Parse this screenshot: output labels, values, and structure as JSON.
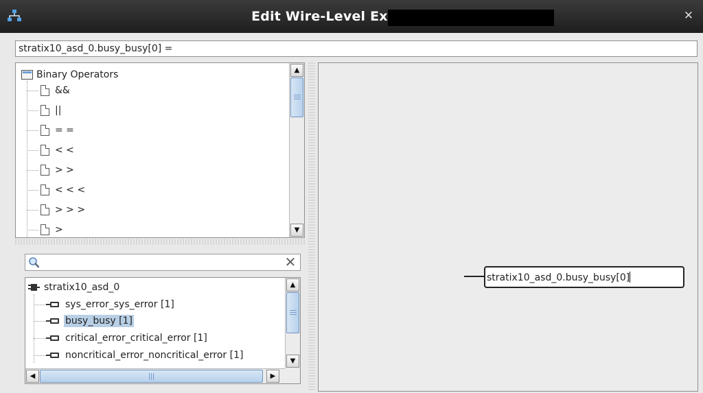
{
  "window": {
    "title": "Edit Wire-Level Expression",
    "close_icon": "close-icon",
    "app_icon": "network-icon"
  },
  "expression": {
    "value": "stratix10_asd_0.busy_busy[0] ="
  },
  "operators": {
    "root_label": "Binary Operators",
    "items": [
      "&&",
      "||",
      "= =",
      "< <",
      "> >",
      "< < <",
      "> > >",
      ">"
    ]
  },
  "search": {
    "value": "",
    "search_icon": "search-icon",
    "clear_icon": "clear-icon"
  },
  "signals": {
    "root_label": "stratix10_asd_0",
    "items": [
      {
        "label": "sys_error_sys_error [1]",
        "selected": false
      },
      {
        "label": "busy_busy [1]",
        "selected": true
      },
      {
        "label": "critical_error_critical_error [1]",
        "selected": false
      },
      {
        "label": "noncritical_error_noncritical_error [1]",
        "selected": false
      }
    ]
  },
  "canvas": {
    "wire_label": "stratix10_asd_0.busy_busy[0]"
  },
  "colors": {
    "selection": "#b8cfe5",
    "titlebar": "#2a2a2a",
    "scroll_thumb": "#b8d1ec"
  }
}
